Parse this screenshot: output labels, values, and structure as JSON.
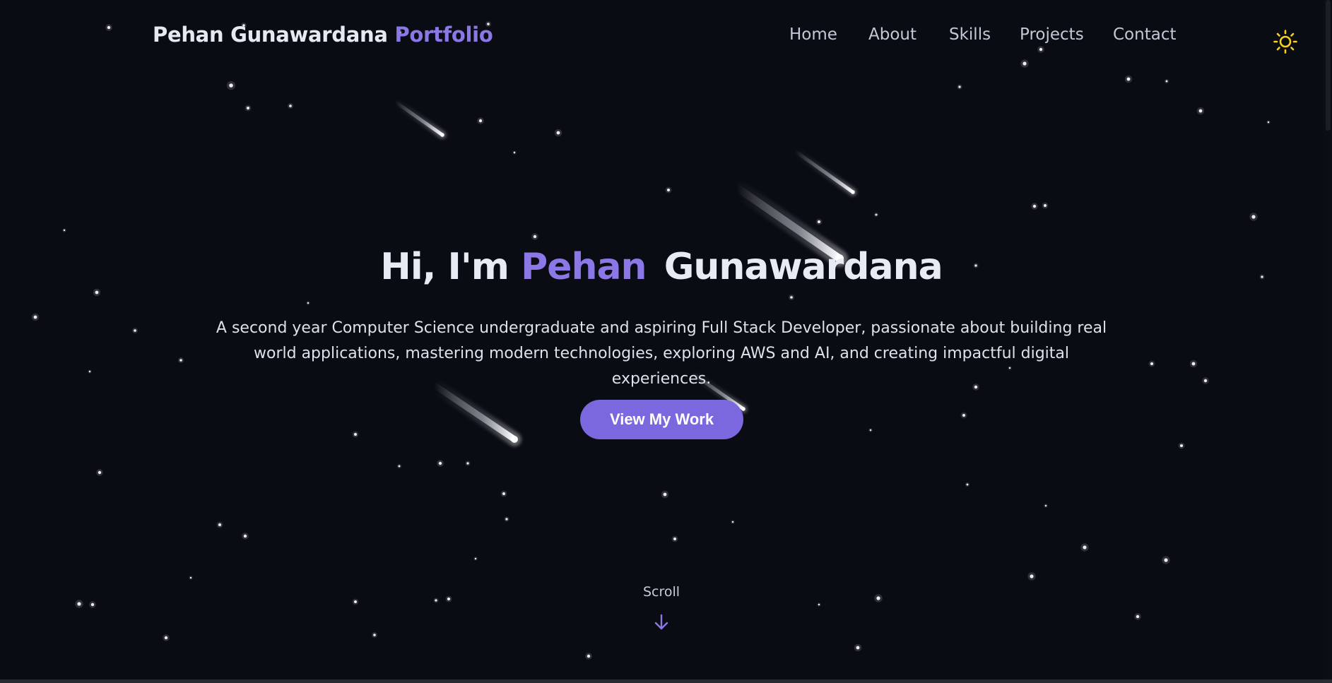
{
  "nav": {
    "brand_name": "Pehan Gunawardana",
    "brand_accent": "Portfolio",
    "links": [
      "Home",
      "About",
      "Skills",
      "Projects",
      "Contact"
    ],
    "theme_icon": "sun-icon"
  },
  "hero": {
    "greeting": "Hi, I'm",
    "first_name": "Pehan",
    "last_name": "Gunawardana",
    "description": "A second year Computer Science undergraduate and aspiring Full Stack Developer, passionate about building real world applications, mastering modern technologies, exploring AWS and AI, and creating impactful digital experiences.",
    "cta_label": "View My Work"
  },
  "scroll": {
    "label": "Scroll",
    "icon": "arrow-down-icon"
  },
  "colors": {
    "background": "#0a0c14",
    "accent": "#8b78e6",
    "button": "#7b68de",
    "sun": "#f5d020"
  }
}
